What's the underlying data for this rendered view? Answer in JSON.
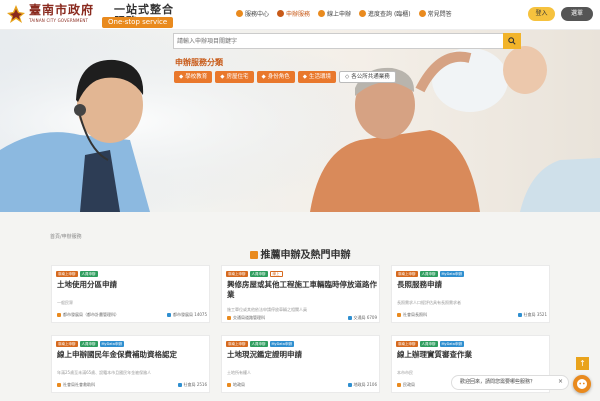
{
  "header": {
    "logo_gov": "臺南市政府",
    "logo_en": "TAINAN CITY GOVERNMENT",
    "logo_cn": "一站式整合服務",
    "logo_tag": "One-stop service",
    "nav": [
      {
        "label": "服務中心",
        "icon": "home-icon"
      },
      {
        "label": "申辦服務",
        "icon": "document-icon"
      },
      {
        "label": "線上申辦",
        "icon": "computer-icon"
      },
      {
        "label": "進度查詢 (臨櫃)",
        "icon": "search-icon"
      },
      {
        "label": "常見問答",
        "icon": "question-icon"
      }
    ],
    "login": "登入",
    "menu": "選單"
  },
  "search": {
    "placeholder": "請輸入申辦項目關鍵字"
  },
  "categories": {
    "title": "申辦服務分類",
    "items": [
      "學校教育",
      "房屋住宅",
      "身份角色",
      "生活環境",
      "各公所共通業務"
    ]
  },
  "breadcrumb": "首頁/申辦服務",
  "section_title": "推薦申辦及熱門申辦",
  "cards": [
    {
      "tags": [
        "臺南上申辦",
        "人員申辦"
      ],
      "title": "土地使用分區申請",
      "desc": "一般民眾",
      "dept": "都市發展局（都市計畫管理科）",
      "meta": "都市發展局 14075"
    },
    {
      "tags": [
        "臺南上申辦",
        "人員申辦",
        "線上"
      ],
      "title": "興修房屋或其他工程施工車輛臨時停放道路作業",
      "desc": "施工單位或其他依法申請停放車輛之相關人員",
      "dept": "交通局道路管理科",
      "meta": "交通局 6709"
    },
    {
      "tags": [
        "臺南上申辦",
        "人員申辦",
        "MyData申辦"
      ],
      "title": "長照服務申請",
      "desc": "長照需求人口經評估具有長照需求者",
      "dept": "社會局長照科",
      "meta": "社會局 3521"
    },
    {
      "tags": [
        "臺南上申辦",
        "人員申辦",
        "MyData申辦"
      ],
      "title": "線上申辦國民年金保費補助資格認定",
      "desc": "年滿25歲至未滿65歲、設籍本市且國民年金被保險人",
      "dept": "社會局社會救助科",
      "meta": "社會局 2516"
    },
    {
      "tags": [
        "臺南上申辦",
        "人員申辦",
        "MyData申辦"
      ],
      "title": "土地現況鑑定證明申請",
      "desc": "土地所有權人",
      "dept": "地政局",
      "meta": "地政局 2106"
    },
    {
      "tags": [
        "臺南上申辦",
        "人員申辦",
        "MyData申辦"
      ],
      "title": "線上辦理實質審查作業",
      "desc": "本市市民",
      "dept": "民政局",
      "meta": "民政局 1831"
    }
  ],
  "chat": {
    "prompt": "歡迎回來，請問您需要哪些服務？",
    "close": "×"
  },
  "back_to_top": "↑",
  "colors": {
    "brand": "#e98a1e",
    "brand_dark": "#c85a18",
    "login_bg": "#f6c23e",
    "tag_green": "#2f9e5e",
    "tag_blue": "#2f8fd0"
  }
}
